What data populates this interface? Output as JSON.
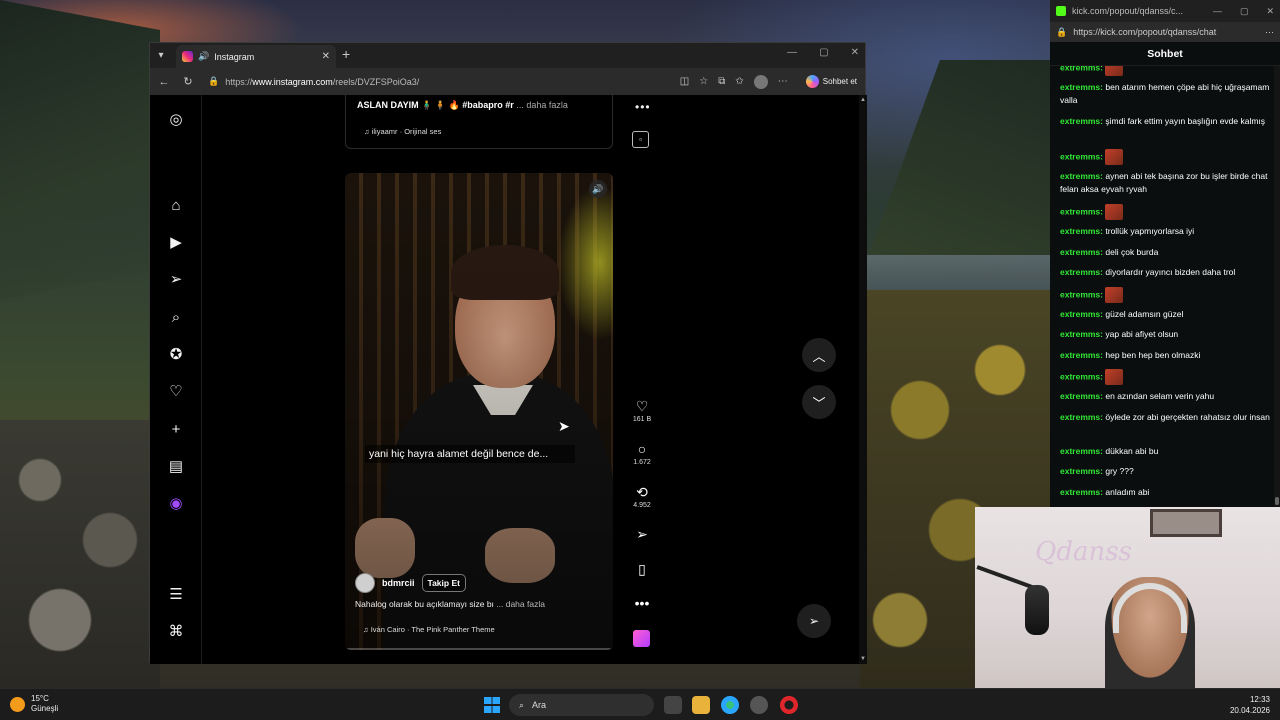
{
  "browser": {
    "tab_title": "Instagram",
    "url_prefix": "https://",
    "url_host": "www.instagram.com",
    "url_path": "/reels/DVZFSPoiOa3/",
    "copilot_label": "Sohbet et"
  },
  "prev_reel": {
    "caption": "ASLAN DAYIM 🧍‍♂️ 🧍 🔥 #babapro #r",
    "more": "... daha fazla",
    "audio": "iliyaamr · Orijinal ses"
  },
  "reel": {
    "subtitle": "yani hiç hayra alamet değil bence de...",
    "username": "bdmrcii",
    "follow_label": "Takip Et",
    "caption": "Nahalog olarak bu açıklamayı size bı",
    "more": "... daha fazla",
    "audio": "Iván Cairo · The Pink Panther Theme",
    "progress": 0.0
  },
  "actions": {
    "likes": "161 B",
    "comments": "1.672",
    "reposts": "4.952"
  },
  "chat": {
    "window_title": "kick.com/popout/qdanss/c...",
    "url": "https://kick.com/popout/qdanss/chat",
    "header": "Sohbet",
    "messages": [
      {
        "user": "extremms:",
        "text": "",
        "emote": true
      },
      {
        "user": "extremms:",
        "text": "ben atarım hemen çöpe abi hiç uğraşamam valla",
        "emote": false
      },
      {
        "user": "extremms:",
        "text": "şimdi fark ettim yayın başlığın evde kalmış",
        "emote": false
      },
      {
        "user": "extremms:",
        "text": "",
        "emote": true
      },
      {
        "user": "extremms:",
        "text": "aynen abi tek başına zor bu işler birde chat felan aksa eyvah ryvah",
        "emote": false
      },
      {
        "user": "extremms:",
        "text": "",
        "emote": true
      },
      {
        "user": "extremms:",
        "text": "trollük yapmıyorlarsa iyi",
        "emote": false
      },
      {
        "user": "extremms:",
        "text": "deli çok burda",
        "emote": false
      },
      {
        "user": "extremms:",
        "text": "diyorlardır yayıncı bizden daha trol",
        "emote": false
      },
      {
        "user": "extremms:",
        "text": "",
        "emote": true
      },
      {
        "user": "extremms:",
        "text": "güzel adamsın güzel",
        "emote": false
      },
      {
        "user": "extremms:",
        "text": "yap abi afiyet olsun",
        "emote": false
      },
      {
        "user": "extremms:",
        "text": "hep ben hep ben olmazki",
        "emote": false
      },
      {
        "user": "extremms:",
        "text": "",
        "emote": true
      },
      {
        "user": "extremms:",
        "text": "en azından selam verin yahu",
        "emote": false
      },
      {
        "user": "extremms:",
        "text": "öylede zor abi gerçekten rahatsız olur insan",
        "emote": false
      },
      {
        "user": "extremms:",
        "text": "dükkan abi bu",
        "emote": false
      },
      {
        "user": "extremms:",
        "text": "gry ???",
        "emote": false
      },
      {
        "user": "extremms:",
        "text": "anladım abi",
        "emote": false
      }
    ]
  },
  "webcam": {
    "neon_sign": "Qdanss"
  },
  "taskbar": {
    "temperature": "15°C",
    "weather": "Güneşli",
    "search_placeholder": "Ara",
    "time": "12:33",
    "date": "20.04.2026"
  },
  "colors": {
    "chat_username": "#31e836",
    "kick_green": "#53fc18",
    "edge_accent": "#2aa6ff"
  }
}
